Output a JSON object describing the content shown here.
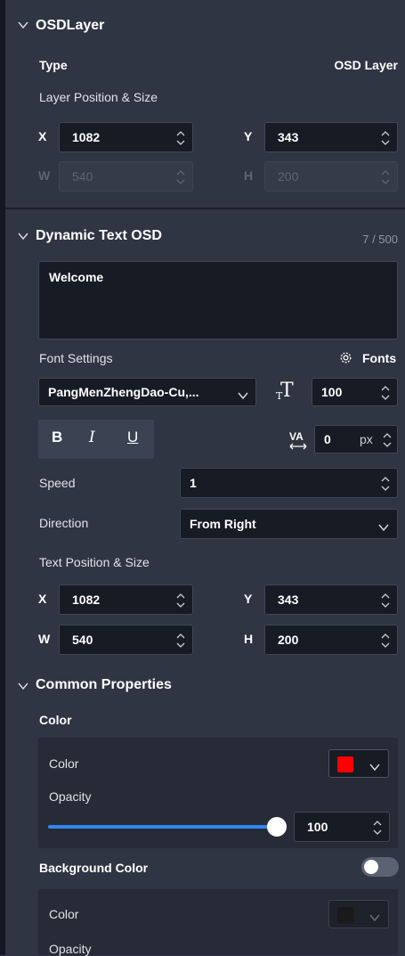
{
  "osd_layer": {
    "title": "OSDLayer",
    "type_label": "Type",
    "type_value": "OSD Layer",
    "position_size_label": "Layer Position & Size",
    "x_label": "X",
    "x_value": "1082",
    "y_label": "Y",
    "y_value": "343",
    "w_label": "W",
    "w_value": "540",
    "h_label": "H",
    "h_value": "200"
  },
  "dynamic_text": {
    "title": "Dynamic Text OSD",
    "char_count": "7 / 500",
    "text_value": "Welcome",
    "font_settings_label": "Font Settings",
    "fonts_link": "Fonts",
    "font_family_value": "PangMenZhengDao-Cu,...",
    "font_size_value": "100",
    "bold_label": "B",
    "italic_label": "I",
    "underline_label": "U",
    "letter_spacing_value": "0",
    "letter_spacing_unit": "px",
    "speed_label": "Speed",
    "speed_value": "1",
    "direction_label": "Direction",
    "direction_value": "From Right",
    "text_position_label": "Text Position & Size",
    "x_label": "X",
    "x_value": "1082",
    "y_label": "Y",
    "y_value": "343",
    "w_label": "W",
    "w_value": "540",
    "h_label": "H",
    "h_value": "200"
  },
  "common": {
    "title": "Common Properties",
    "color_section_label": "Color",
    "color_label": "Color",
    "color_value": "#ff0000",
    "opacity_label": "Opacity",
    "opacity_value": "100",
    "background_color_label": "Background Color",
    "background_enabled": false,
    "bg_color_label": "Color",
    "bg_color_value": "#1a1a1a",
    "bg_opacity_label": "Opacity"
  },
  "icons": [
    "chevron-down-icon",
    "spinner-icon",
    "gear-icon",
    "font-size-icon",
    "letter-spacing-icon"
  ],
  "colors": {
    "panel": "#2f3542",
    "input": "#161b24",
    "accent": "#3487ef"
  }
}
